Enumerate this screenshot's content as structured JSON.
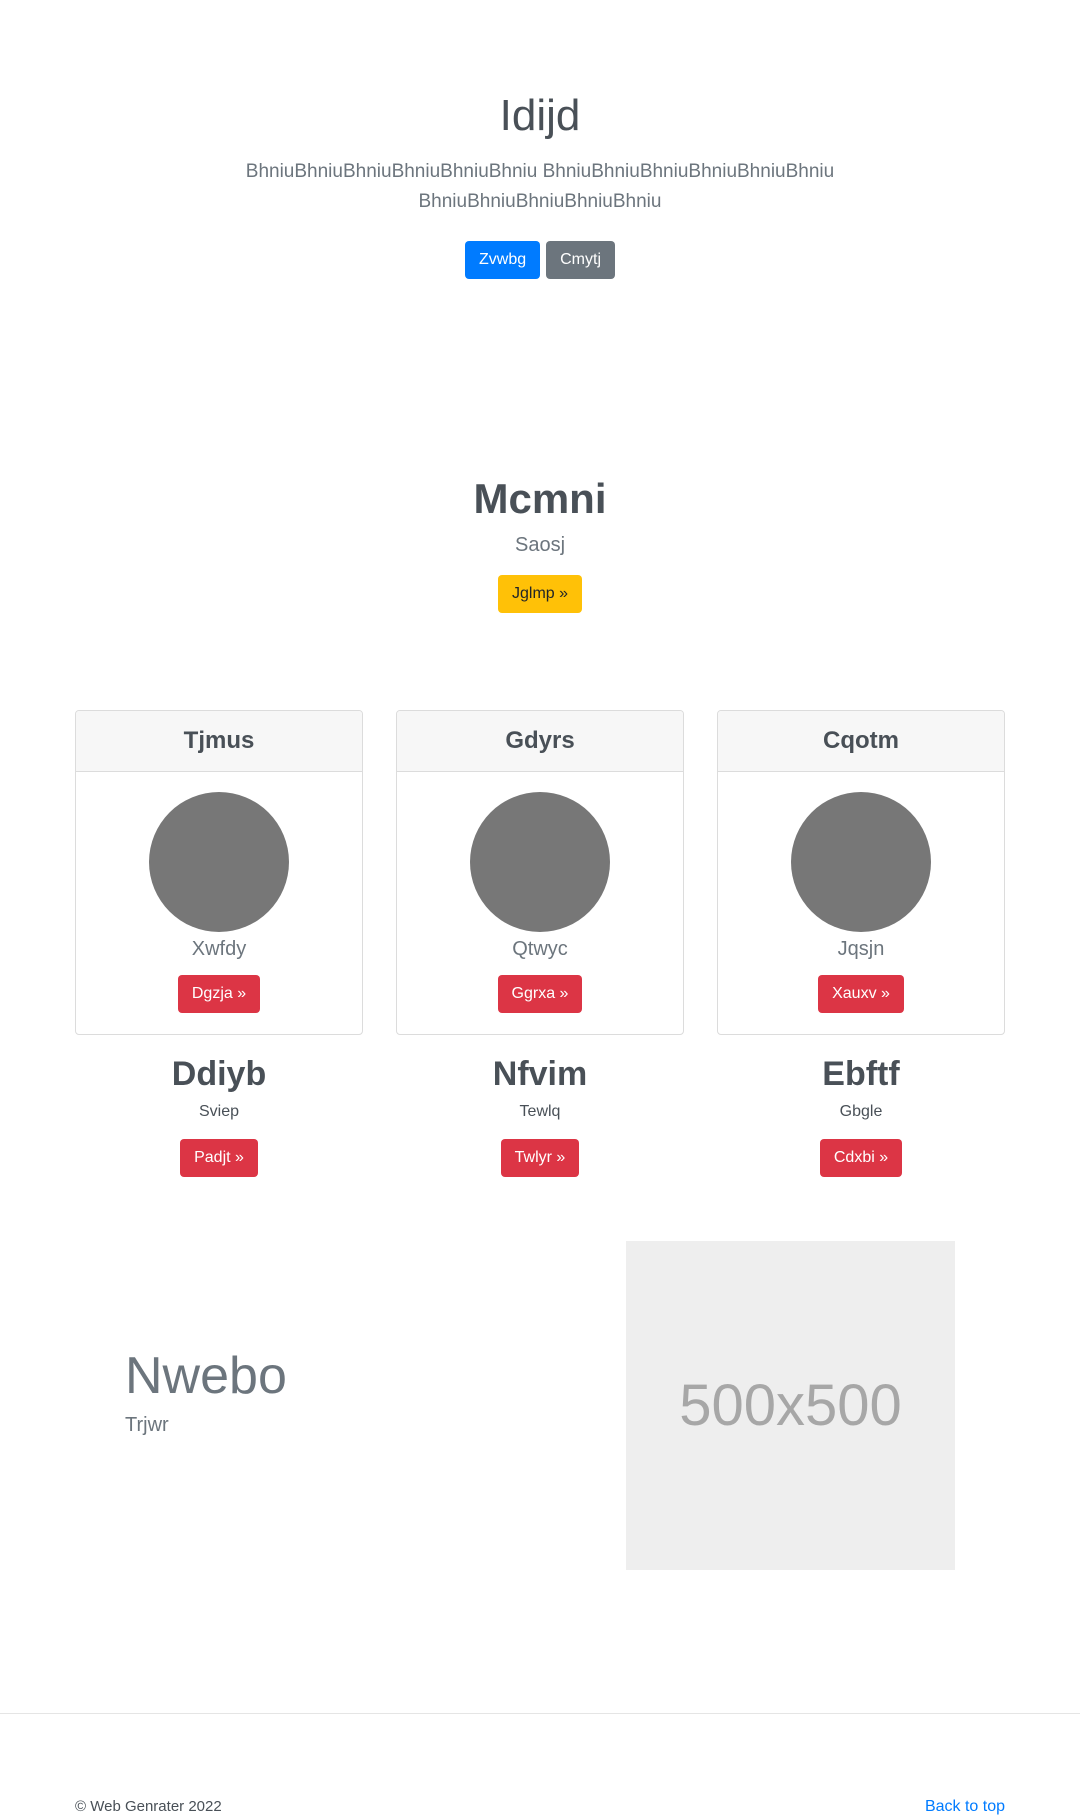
{
  "hero": {
    "title": "Idijd",
    "lead": "BhniuBhniuBhniuBhniuBhniuBhniu BhniuBhniuBhniuBhniuBhniuBhniu BhniuBhniuBhniuBhniuBhniu",
    "primary_button": "Zvwbg",
    "secondary_button": "Cmytj"
  },
  "feature": {
    "title": "Mcmni",
    "subtitle": "Saosj",
    "button": "Jglmp »"
  },
  "cards": [
    {
      "header": "Tjmus",
      "text": "Xwfdy",
      "button": "Dgzja »"
    },
    {
      "header": "Gdyrs",
      "text": "Qtwyc",
      "button": "Ggrxa »"
    },
    {
      "header": "Cqotm",
      "text": "Jqsjn",
      "button": "Xauxv »"
    }
  ],
  "columns": [
    {
      "title": "Ddiyb",
      "text": "Sviep",
      "button": "Padjt »"
    },
    {
      "title": "Nfvim",
      "text": "Tewlq",
      "button": "Twlyr »"
    },
    {
      "title": "Ebftf",
      "text": "Gbgle",
      "button": "Cdxbi »"
    }
  ],
  "split": {
    "title": "Nwebo",
    "subtitle": "Trjwr",
    "image_label": "500x500"
  },
  "footer": {
    "copyright": "© Web Genrater 2022",
    "back_to_top": "Back to top"
  },
  "colors": {
    "primary": "#007bff",
    "secondary": "#6c757d",
    "warning": "#ffc107",
    "danger": "#dc3545",
    "avatar": "#777777",
    "placeholder_bg": "#eeeeee"
  }
}
